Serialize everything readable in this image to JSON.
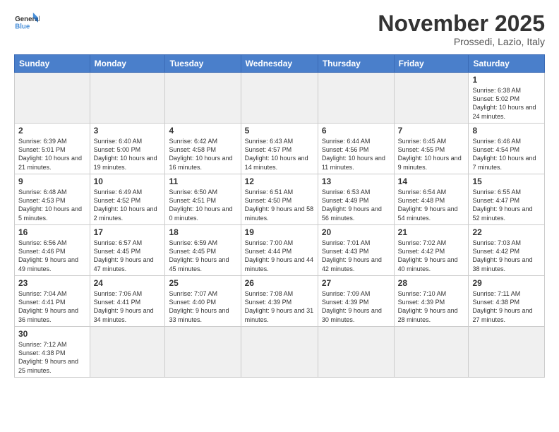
{
  "header": {
    "logo_general": "General",
    "logo_blue": "Blue",
    "month_title": "November 2025",
    "location": "Prossedi, Lazio, Italy"
  },
  "weekdays": [
    "Sunday",
    "Monday",
    "Tuesday",
    "Wednesday",
    "Thursday",
    "Friday",
    "Saturday"
  ],
  "weeks": [
    [
      {
        "day": "",
        "info": ""
      },
      {
        "day": "",
        "info": ""
      },
      {
        "day": "",
        "info": ""
      },
      {
        "day": "",
        "info": ""
      },
      {
        "day": "",
        "info": ""
      },
      {
        "day": "",
        "info": ""
      },
      {
        "day": "1",
        "info": "Sunrise: 6:38 AM\nSunset: 5:02 PM\nDaylight: 10 hours and 24 minutes."
      }
    ],
    [
      {
        "day": "2",
        "info": "Sunrise: 6:39 AM\nSunset: 5:01 PM\nDaylight: 10 hours and 21 minutes."
      },
      {
        "day": "3",
        "info": "Sunrise: 6:40 AM\nSunset: 5:00 PM\nDaylight: 10 hours and 19 minutes."
      },
      {
        "day": "4",
        "info": "Sunrise: 6:42 AM\nSunset: 4:58 PM\nDaylight: 10 hours and 16 minutes."
      },
      {
        "day": "5",
        "info": "Sunrise: 6:43 AM\nSunset: 4:57 PM\nDaylight: 10 hours and 14 minutes."
      },
      {
        "day": "6",
        "info": "Sunrise: 6:44 AM\nSunset: 4:56 PM\nDaylight: 10 hours and 11 minutes."
      },
      {
        "day": "7",
        "info": "Sunrise: 6:45 AM\nSunset: 4:55 PM\nDaylight: 10 hours and 9 minutes."
      },
      {
        "day": "8",
        "info": "Sunrise: 6:46 AM\nSunset: 4:54 PM\nDaylight: 10 hours and 7 minutes."
      }
    ],
    [
      {
        "day": "9",
        "info": "Sunrise: 6:48 AM\nSunset: 4:53 PM\nDaylight: 10 hours and 5 minutes."
      },
      {
        "day": "10",
        "info": "Sunrise: 6:49 AM\nSunset: 4:52 PM\nDaylight: 10 hours and 2 minutes."
      },
      {
        "day": "11",
        "info": "Sunrise: 6:50 AM\nSunset: 4:51 PM\nDaylight: 10 hours and 0 minutes."
      },
      {
        "day": "12",
        "info": "Sunrise: 6:51 AM\nSunset: 4:50 PM\nDaylight: 9 hours and 58 minutes."
      },
      {
        "day": "13",
        "info": "Sunrise: 6:53 AM\nSunset: 4:49 PM\nDaylight: 9 hours and 56 minutes."
      },
      {
        "day": "14",
        "info": "Sunrise: 6:54 AM\nSunset: 4:48 PM\nDaylight: 9 hours and 54 minutes."
      },
      {
        "day": "15",
        "info": "Sunrise: 6:55 AM\nSunset: 4:47 PM\nDaylight: 9 hours and 52 minutes."
      }
    ],
    [
      {
        "day": "16",
        "info": "Sunrise: 6:56 AM\nSunset: 4:46 PM\nDaylight: 9 hours and 49 minutes."
      },
      {
        "day": "17",
        "info": "Sunrise: 6:57 AM\nSunset: 4:45 PM\nDaylight: 9 hours and 47 minutes."
      },
      {
        "day": "18",
        "info": "Sunrise: 6:59 AM\nSunset: 4:45 PM\nDaylight: 9 hours and 45 minutes."
      },
      {
        "day": "19",
        "info": "Sunrise: 7:00 AM\nSunset: 4:44 PM\nDaylight: 9 hours and 44 minutes."
      },
      {
        "day": "20",
        "info": "Sunrise: 7:01 AM\nSunset: 4:43 PM\nDaylight: 9 hours and 42 minutes."
      },
      {
        "day": "21",
        "info": "Sunrise: 7:02 AM\nSunset: 4:42 PM\nDaylight: 9 hours and 40 minutes."
      },
      {
        "day": "22",
        "info": "Sunrise: 7:03 AM\nSunset: 4:42 PM\nDaylight: 9 hours and 38 minutes."
      }
    ],
    [
      {
        "day": "23",
        "info": "Sunrise: 7:04 AM\nSunset: 4:41 PM\nDaylight: 9 hours and 36 minutes."
      },
      {
        "day": "24",
        "info": "Sunrise: 7:06 AM\nSunset: 4:41 PM\nDaylight: 9 hours and 34 minutes."
      },
      {
        "day": "25",
        "info": "Sunrise: 7:07 AM\nSunset: 4:40 PM\nDaylight: 9 hours and 33 minutes."
      },
      {
        "day": "26",
        "info": "Sunrise: 7:08 AM\nSunset: 4:39 PM\nDaylight: 9 hours and 31 minutes."
      },
      {
        "day": "27",
        "info": "Sunrise: 7:09 AM\nSunset: 4:39 PM\nDaylight: 9 hours and 30 minutes."
      },
      {
        "day": "28",
        "info": "Sunrise: 7:10 AM\nSunset: 4:39 PM\nDaylight: 9 hours and 28 minutes."
      },
      {
        "day": "29",
        "info": "Sunrise: 7:11 AM\nSunset: 4:38 PM\nDaylight: 9 hours and 27 minutes."
      }
    ],
    [
      {
        "day": "30",
        "info": "Sunrise: 7:12 AM\nSunset: 4:38 PM\nDaylight: 9 hours and 25 minutes."
      },
      {
        "day": "",
        "info": ""
      },
      {
        "day": "",
        "info": ""
      },
      {
        "day": "",
        "info": ""
      },
      {
        "day": "",
        "info": ""
      },
      {
        "day": "",
        "info": ""
      },
      {
        "day": "",
        "info": ""
      }
    ]
  ]
}
